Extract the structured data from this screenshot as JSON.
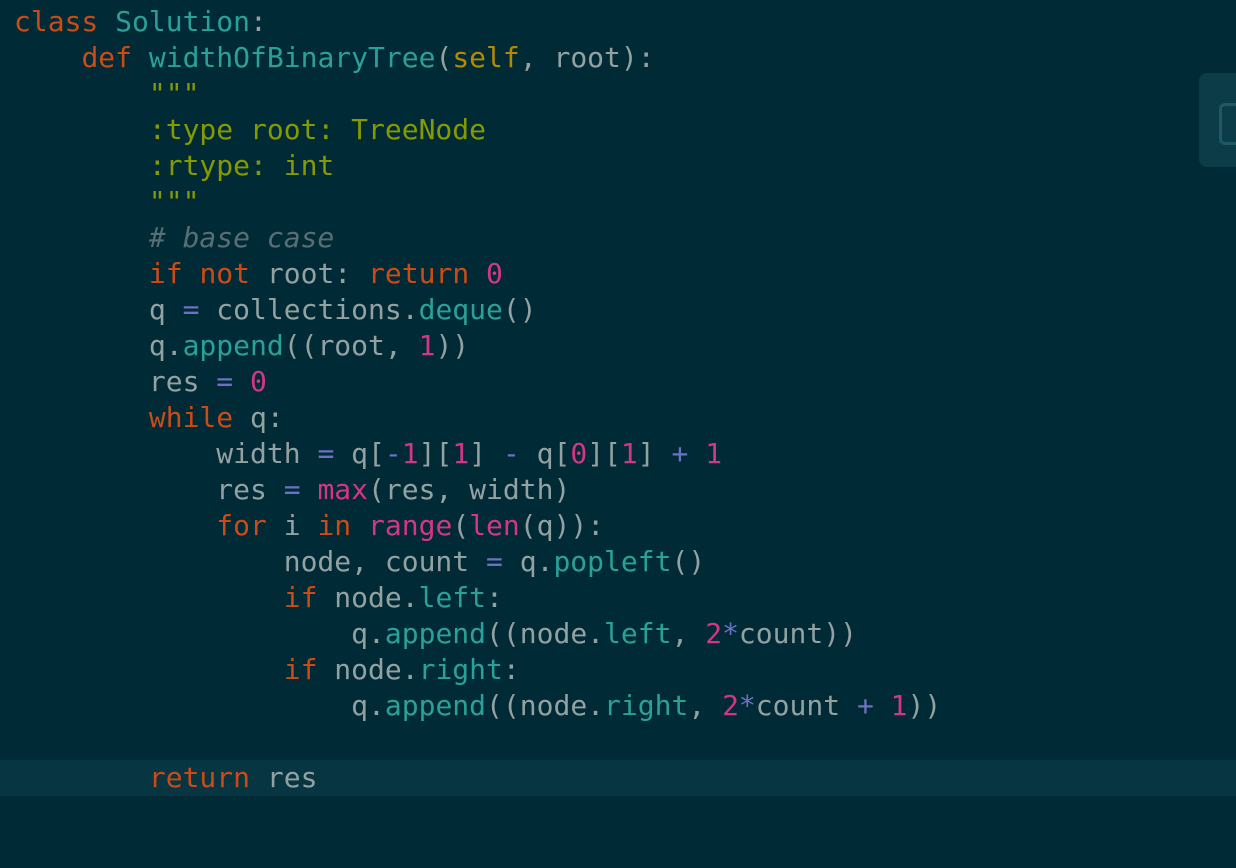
{
  "editor": {
    "language": "python",
    "current_line_index": 21,
    "colors": {
      "background": "#002b36",
      "current_line": "#073642",
      "keyword": "#cb4b16",
      "function": "#2aa198",
      "string": "#859900",
      "number": "#d33682",
      "comment": "#586e75",
      "text": "#93a1a1"
    },
    "lines": [
      [
        {
          "t": "kw",
          "v": "class"
        },
        {
          "t": "txt",
          "v": " "
        },
        {
          "t": "cls",
          "v": "Solution"
        },
        {
          "t": "txt",
          "v": ":"
        }
      ],
      [
        {
          "t": "txt",
          "v": "    "
        },
        {
          "t": "kw",
          "v": "def"
        },
        {
          "t": "txt",
          "v": " "
        },
        {
          "t": "fn",
          "v": "widthOfBinaryTree"
        },
        {
          "t": "txt",
          "v": "("
        },
        {
          "t": "self",
          "v": "self"
        },
        {
          "t": "txt",
          "v": ", root):"
        }
      ],
      [
        {
          "t": "txt",
          "v": "        "
        },
        {
          "t": "str",
          "v": "\"\"\""
        }
      ],
      [
        {
          "t": "txt",
          "v": "        "
        },
        {
          "t": "str",
          "v": ":type root: TreeNode"
        }
      ],
      [
        {
          "t": "txt",
          "v": "        "
        },
        {
          "t": "str",
          "v": ":rtype: int"
        }
      ],
      [
        {
          "t": "txt",
          "v": "        "
        },
        {
          "t": "str",
          "v": "\"\"\""
        }
      ],
      [
        {
          "t": "txt",
          "v": "        "
        },
        {
          "t": "cmt",
          "v": "# base case"
        }
      ],
      [
        {
          "t": "txt",
          "v": "        "
        },
        {
          "t": "kw",
          "v": "if"
        },
        {
          "t": "txt",
          "v": " "
        },
        {
          "t": "kw",
          "v": "not"
        },
        {
          "t": "txt",
          "v": " root: "
        },
        {
          "t": "kw",
          "v": "return"
        },
        {
          "t": "txt",
          "v": " "
        },
        {
          "t": "num",
          "v": "0"
        }
      ],
      [
        {
          "t": "txt",
          "v": "        q "
        },
        {
          "t": "op",
          "v": "="
        },
        {
          "t": "txt",
          "v": " collections."
        },
        {
          "t": "attr",
          "v": "deque"
        },
        {
          "t": "txt",
          "v": "()"
        }
      ],
      [
        {
          "t": "txt",
          "v": "        q."
        },
        {
          "t": "attr",
          "v": "append"
        },
        {
          "t": "txt",
          "v": "((root, "
        },
        {
          "t": "num",
          "v": "1"
        },
        {
          "t": "txt",
          "v": "))"
        }
      ],
      [
        {
          "t": "txt",
          "v": "        res "
        },
        {
          "t": "op",
          "v": "="
        },
        {
          "t": "txt",
          "v": " "
        },
        {
          "t": "num",
          "v": "0"
        }
      ],
      [
        {
          "t": "txt",
          "v": "        "
        },
        {
          "t": "kw",
          "v": "while"
        },
        {
          "t": "txt",
          "v": " q:"
        }
      ],
      [
        {
          "t": "txt",
          "v": "            width "
        },
        {
          "t": "op",
          "v": "="
        },
        {
          "t": "txt",
          "v": " q["
        },
        {
          "t": "op",
          "v": "-"
        },
        {
          "t": "num",
          "v": "1"
        },
        {
          "t": "txt",
          "v": "]["
        },
        {
          "t": "num",
          "v": "1"
        },
        {
          "t": "txt",
          "v": "] "
        },
        {
          "t": "op",
          "v": "-"
        },
        {
          "t": "txt",
          "v": " q["
        },
        {
          "t": "num",
          "v": "0"
        },
        {
          "t": "txt",
          "v": "]["
        },
        {
          "t": "num",
          "v": "1"
        },
        {
          "t": "txt",
          "v": "] "
        },
        {
          "t": "op",
          "v": "+"
        },
        {
          "t": "txt",
          "v": " "
        },
        {
          "t": "num",
          "v": "1"
        }
      ],
      [
        {
          "t": "txt",
          "v": "            res "
        },
        {
          "t": "op",
          "v": "="
        },
        {
          "t": "txt",
          "v": " "
        },
        {
          "t": "bi",
          "v": "max"
        },
        {
          "t": "txt",
          "v": "(res, width)"
        }
      ],
      [
        {
          "t": "txt",
          "v": "            "
        },
        {
          "t": "kw",
          "v": "for"
        },
        {
          "t": "txt",
          "v": " i "
        },
        {
          "t": "kw",
          "v": "in"
        },
        {
          "t": "txt",
          "v": " "
        },
        {
          "t": "bi",
          "v": "range"
        },
        {
          "t": "txt",
          "v": "("
        },
        {
          "t": "bi",
          "v": "len"
        },
        {
          "t": "txt",
          "v": "(q)):"
        }
      ],
      [
        {
          "t": "txt",
          "v": "                node, count "
        },
        {
          "t": "op",
          "v": "="
        },
        {
          "t": "txt",
          "v": " q."
        },
        {
          "t": "attr",
          "v": "popleft"
        },
        {
          "t": "txt",
          "v": "()"
        }
      ],
      [
        {
          "t": "txt",
          "v": "                "
        },
        {
          "t": "kw",
          "v": "if"
        },
        {
          "t": "txt",
          "v": " node."
        },
        {
          "t": "attr",
          "v": "left"
        },
        {
          "t": "txt",
          "v": ":"
        }
      ],
      [
        {
          "t": "txt",
          "v": "                    q."
        },
        {
          "t": "attr",
          "v": "append"
        },
        {
          "t": "txt",
          "v": "((node."
        },
        {
          "t": "attr",
          "v": "left"
        },
        {
          "t": "txt",
          "v": ", "
        },
        {
          "t": "num",
          "v": "2"
        },
        {
          "t": "op",
          "v": "*"
        },
        {
          "t": "txt",
          "v": "count))"
        }
      ],
      [
        {
          "t": "txt",
          "v": "                "
        },
        {
          "t": "kw",
          "v": "if"
        },
        {
          "t": "txt",
          "v": " node."
        },
        {
          "t": "attr",
          "v": "right"
        },
        {
          "t": "txt",
          "v": ":"
        }
      ],
      [
        {
          "t": "txt",
          "v": "                    q."
        },
        {
          "t": "attr",
          "v": "append"
        },
        {
          "t": "txt",
          "v": "((node."
        },
        {
          "t": "attr",
          "v": "right"
        },
        {
          "t": "txt",
          "v": ", "
        },
        {
          "t": "num",
          "v": "2"
        },
        {
          "t": "op",
          "v": "*"
        },
        {
          "t": "txt",
          "v": "count "
        },
        {
          "t": "op",
          "v": "+"
        },
        {
          "t": "txt",
          "v": " "
        },
        {
          "t": "num",
          "v": "1"
        },
        {
          "t": "txt",
          "v": "))"
        }
      ],
      [],
      [
        {
          "t": "txt",
          "v": "        "
        },
        {
          "t": "kw",
          "v": "return"
        },
        {
          "t": "txt",
          "v": " res"
        }
      ]
    ]
  },
  "side_panel": {
    "icon": "panel-tab-icon"
  }
}
